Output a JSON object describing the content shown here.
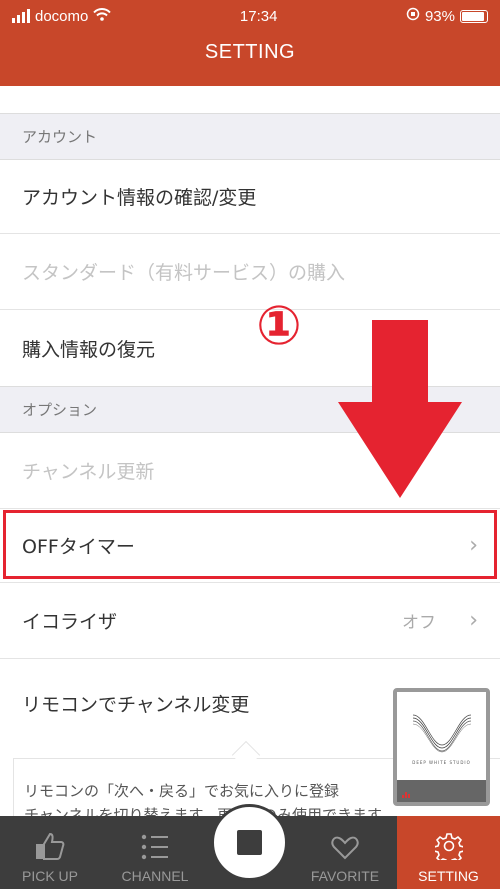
{
  "status": {
    "carrier": "docomo",
    "time": "17:34",
    "battery": "93%",
    "battery_level": 0.93
  },
  "header": {
    "title": "SETTING"
  },
  "sections": [
    {
      "label": "アカウント"
    },
    {
      "label": "オプション"
    }
  ],
  "account_rows": [
    {
      "label": "アカウント情報の確認/変更",
      "enabled": true
    },
    {
      "label": "スタンダード（有料サービス）の購入",
      "enabled": false
    },
    {
      "label": "購入情報の復元",
      "enabled": true
    }
  ],
  "option_rows": [
    {
      "label": "チャンネル更新",
      "enabled": false
    },
    {
      "label": "OFFタイマー",
      "enabled": true
    },
    {
      "label": "イコライザ",
      "value": "オフ",
      "enabled": true
    },
    {
      "label": "リモコンでチャンネル変更",
      "enabled": true
    }
  ],
  "annotation": {
    "number": "①",
    "color": "#e52330"
  },
  "tooltip": {
    "line1": "リモコンの「次へ・戻る」でお気に入りに登録",
    "line2": "チャンネルを切り替えます。再生中のみ使用できます"
  },
  "mini_player": {
    "caption": "DEEP WHITE STUDIO"
  },
  "tabs": [
    {
      "label": "PICK UP",
      "icon": "thumbs-up-icon"
    },
    {
      "label": "CHANNEL",
      "icon": "list-icon"
    },
    {
      "label": "FAVORITE",
      "icon": "heart-icon"
    },
    {
      "label": "SETTING",
      "icon": "gear-icon",
      "active": true
    }
  ],
  "colors": {
    "accent": "#c8472a",
    "tabbar": "#3d3d3d",
    "annotation": "#e52330"
  }
}
